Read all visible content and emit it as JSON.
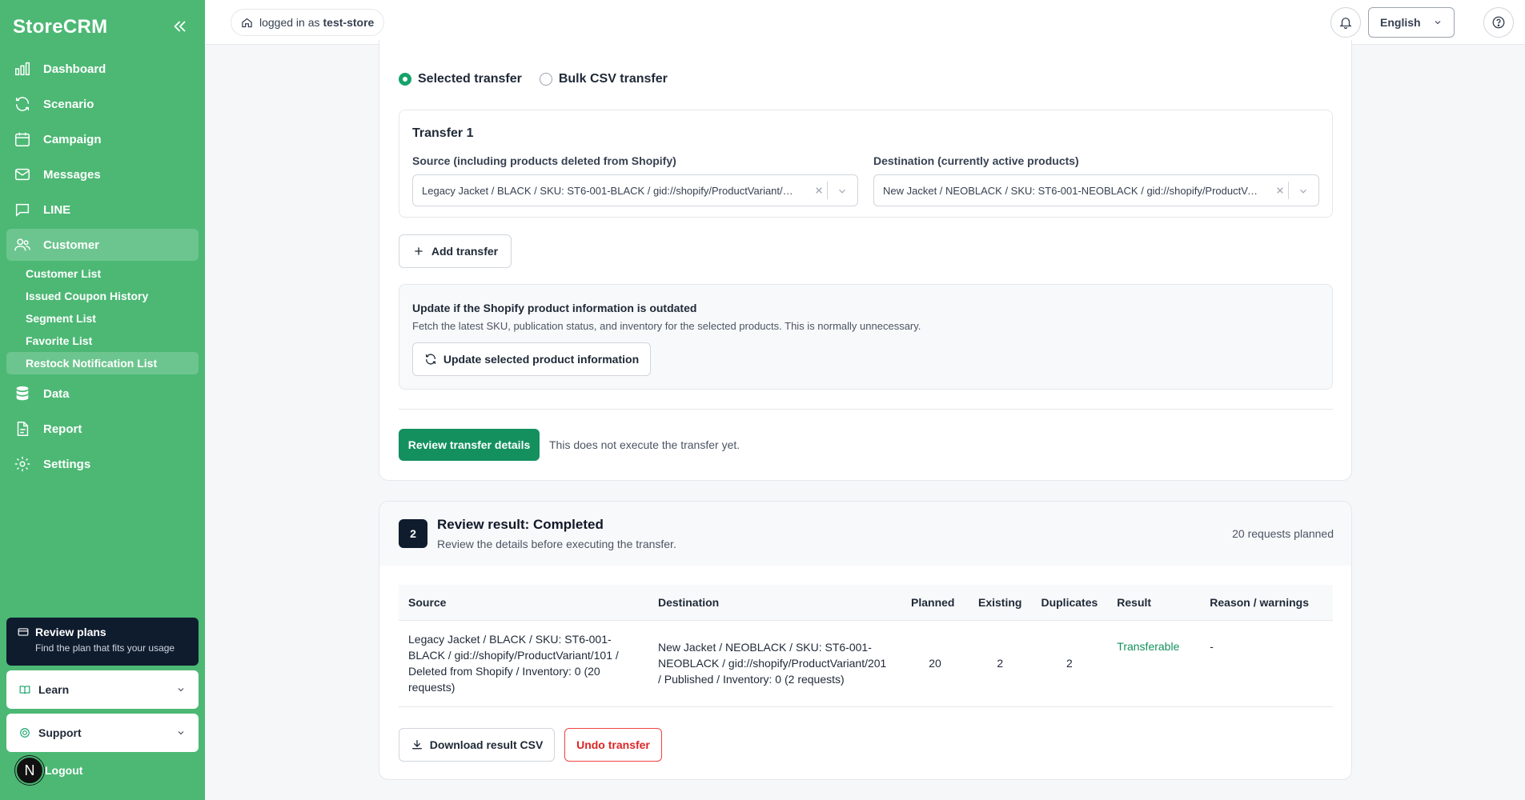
{
  "app": {
    "brand": "StoreCRM"
  },
  "sidebar": {
    "items": [
      {
        "label": "Dashboard"
      },
      {
        "label": "Scenario"
      },
      {
        "label": "Campaign"
      },
      {
        "label": "Messages"
      },
      {
        "label": "LINE"
      },
      {
        "label": "Customer"
      },
      {
        "label": "Data"
      },
      {
        "label": "Report"
      },
      {
        "label": "Settings"
      }
    ],
    "customer_sub": [
      {
        "label": "Customer List"
      },
      {
        "label": "Issued Coupon History"
      },
      {
        "label": "Segment List"
      },
      {
        "label": "Favorite List"
      },
      {
        "label": "Restock Notification List"
      }
    ],
    "plans": {
      "title": "Review plans",
      "subtitle": "Find the plan that fits your usage"
    },
    "learn": "Learn",
    "support": "Support",
    "logout": "Logout",
    "avatar_initial": "N"
  },
  "header": {
    "login_prefix": "logged in as",
    "store": "test-store",
    "language": "English"
  },
  "transfer": {
    "radio_selected": "Selected transfer",
    "radio_bulk": "Bulk CSV transfer",
    "box_title": "Transfer 1",
    "source_label": "Source (including products deleted from Shopify)",
    "source_value": "Legacy Jacket / BLACK / SKU: ST6-001-BLACK / gid://shopify/ProductVariant/101 / Deleted from Shopify / Inventory: 0 (20 requests)",
    "dest_label": "Destination (currently active products)",
    "dest_value": "New Jacket / NEOBLACK / SKU: ST6-001-NEOBLACK / gid://shopify/ProductVariant/201 / Published / Inventory: 0 (2 requests)",
    "add_button": "Add transfer",
    "info_title": "Update if the Shopify product information is outdated",
    "info_desc": "Fetch the latest SKU, publication status, and inventory for the selected products. This is normally unnecessary.",
    "update_button": "Update selected product information",
    "review_button": "Review transfer details",
    "review_note": "This does not execute the transfer yet."
  },
  "result": {
    "step": "2",
    "title": "Review result: Completed",
    "subtitle": "Review the details before executing the transfer.",
    "count": "20 requests planned",
    "columns": [
      "Source",
      "Destination",
      "Planned",
      "Existing",
      "Duplicates",
      "Result",
      "Reason / warnings"
    ],
    "rows": [
      {
        "source": "Legacy Jacket / BLACK / SKU: ST6-001-BLACK / gid://shopify/ProductVariant/101 / Deleted from Shopify / Inventory: 0 (20 requests)",
        "destination": "New Jacket / NEOBLACK / SKU: ST6-001-NEOBLACK / gid://shopify/ProductVariant/201 / Published / Inventory: 0 (2 requests)",
        "planned": "20",
        "existing": "2",
        "duplicates": "2",
        "result": "Transferable",
        "reason": "-"
      }
    ],
    "download_button": "Download result CSV",
    "undo_button": "Undo transfer"
  },
  "colors": {
    "sidebar": "#4cb874",
    "accent": "#13905e",
    "danger": "#dc2626",
    "dark": "#0f1c2e"
  }
}
